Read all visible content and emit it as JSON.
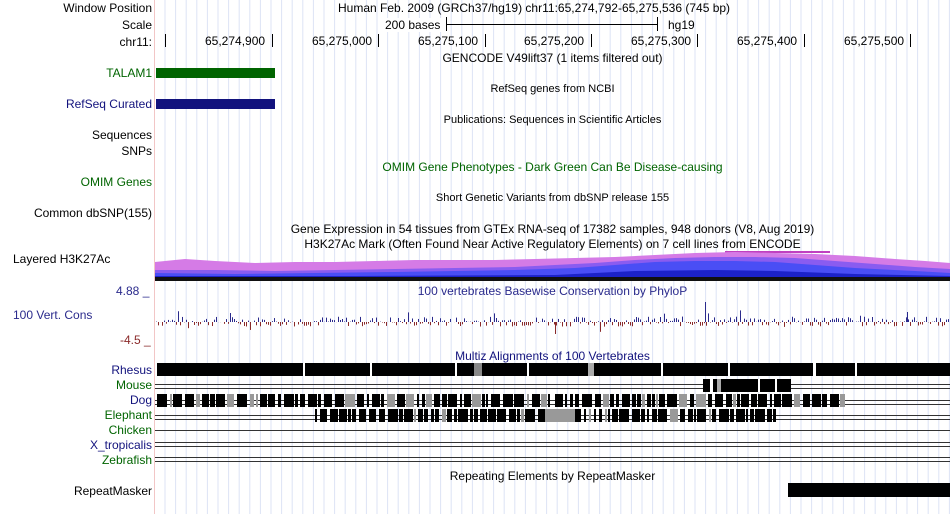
{
  "header": {
    "window_position_label": "Window Position",
    "window_position_value": "Human Feb. 2009 (GRCh37/hg19)   chr11:65,274,792-65,275,536 (745 bp)",
    "scale_label": "Scale",
    "scale_text": "200 bases",
    "assembly": "hg19",
    "chrom_label": "chr11:",
    "ruler_ticks": [
      "65,274,900",
      "65,275,000",
      "65,275,100",
      "65,275,200",
      "65,275,300",
      "65,275,400",
      "65,275,500"
    ]
  },
  "tracks": {
    "gencode": {
      "title": "GENCODE V49lift37 (1 items filtered out)"
    },
    "talam1": {
      "label": "TALAM1",
      "color": "#006400"
    },
    "refseq": {
      "title": "RefSeq genes from NCBI",
      "label": "RefSeq Curated",
      "color": "#12127d"
    },
    "publications": {
      "title": "Publications: Sequences in Scientific Articles"
    },
    "sequences": {
      "label": "Sequences"
    },
    "snps": {
      "label": "SNPs"
    },
    "omim": {
      "title": "OMIM Gene Phenotypes - Dark Green Can Be Disease-causing",
      "label": "OMIM Genes",
      "color": "#006400"
    },
    "dbsnp": {
      "title": "Short Genetic Variants from dbSNP release 155",
      "label": "Common dbSNP(155)"
    },
    "gtex": {
      "title": "Gene Expression in 54 tissues from GTEx RNA-seq of 17382 samples, 948 donors (V8, Aug 2019)"
    },
    "h3k27ac": {
      "title": "H3K27Ac Mark (Often Found Near Active Regulatory Elements) on 7 cell lines from ENCODE",
      "label": "Layered H3K27Ac"
    },
    "conservation": {
      "title": "100 vertebrates Basewise Conservation by PhyloP",
      "label": "100 Vert. Cons",
      "max": "4.88 _",
      "min": "-4.5 _",
      "color": "#2a2a8c"
    },
    "multiz": {
      "title": "Multiz Alignments of 100 Vertebrates",
      "species": [
        {
          "name": "Rhesus",
          "color": "#12127d"
        },
        {
          "name": "Mouse",
          "color": "#006400"
        },
        {
          "name": "Dog",
          "color": "#12127d"
        },
        {
          "name": "Elephant",
          "color": "#006400"
        },
        {
          "name": "Chicken",
          "color": "#006400"
        },
        {
          "name": "X_tropicalis",
          "color": "#12127d"
        },
        {
          "name": "Zebrafish",
          "color": "#006400"
        }
      ]
    },
    "repeatmasker": {
      "title": "Repeating Elements by RepeatMasker",
      "label": "RepeatMasker"
    }
  }
}
